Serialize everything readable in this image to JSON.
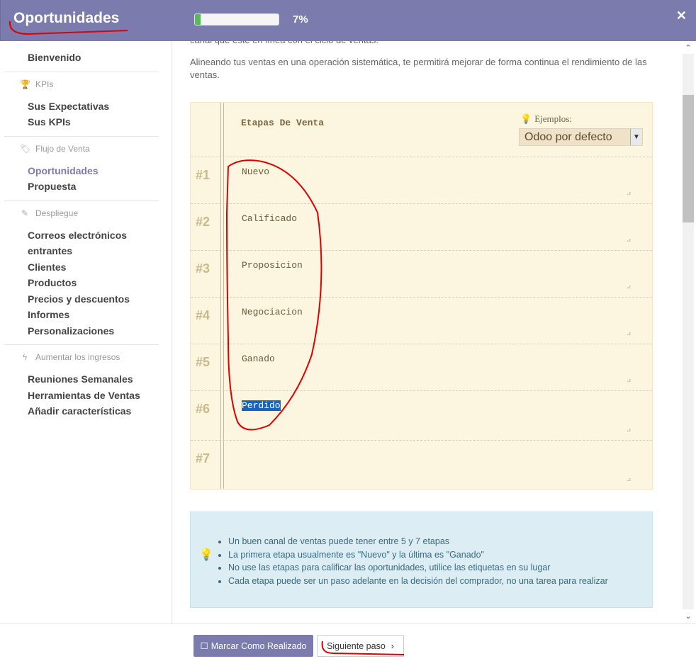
{
  "header": {
    "title": "Oportunidades",
    "progress_percent": 7,
    "progress_label": "7%",
    "close_icon": "close-icon",
    "colors": {
      "header_bg": "#7c7bad",
      "progress_fill": "#5cb85c"
    }
  },
  "sidebar": {
    "top_item": "Bienvenido",
    "groups": [
      {
        "head": "KPIs",
        "icon": "trophy-icon",
        "items": [
          "Sus Expectativas",
          "Sus KPIs"
        ]
      },
      {
        "head": "Flujo de Venta",
        "icon": "tag-icon",
        "items": [
          "Oportunidades",
          "Propuesta"
        ],
        "active": "Oportunidades"
      },
      {
        "head": "Despliegue",
        "icon": "magic-wand-icon",
        "items": [
          "Correos electrónicos entrantes",
          "Clientes",
          "Productos",
          "Precios y descuentos",
          "Informes",
          "Personalizaciones"
        ]
      },
      {
        "head": "Aumentar los ingresos",
        "icon": "bolt-icon",
        "items": [
          "Reuniones Semanales",
          "Herramientas de Ventas",
          "Añadir características"
        ]
      }
    ]
  },
  "main": {
    "intro_cut": "canal que esté en línea con el ciclo de ventas.",
    "intro": "Alineando tus ventas en una operación sistemática, te permitirá mejorar de forma continua el rendimiento de las ventas.",
    "stages_title": "Etapas De Venta",
    "examples_label": "Ejemplos:",
    "examples_value": "Odoo por defecto",
    "stages": [
      {
        "num": "#1",
        "text": "Nuevo"
      },
      {
        "num": "#2",
        "text": "Calificado"
      },
      {
        "num": "#3",
        "text": "Proposicion"
      },
      {
        "num": "#4",
        "text": "Negociacion"
      },
      {
        "num": "#5",
        "text": "Ganado"
      },
      {
        "num": "#6",
        "text": "Perdido"
      },
      {
        "num": "#7",
        "text": ""
      }
    ],
    "tips": [
      "Un buen canal de ventas puede tener entre 5 y 7 etapas",
      "La primera etapa usualmente es \"Nuevo\" y la última es \"Ganado\"",
      "No use las etapas para calificar las oportunidades, utilice las etiquetas en su lugar",
      "Cada etapa puede ser un paso adelante en la decisión del comprador, no una tarea para realizar"
    ]
  },
  "footer": {
    "done_label": "Marcar Como Realizado",
    "next_label": "Siguiente paso"
  }
}
